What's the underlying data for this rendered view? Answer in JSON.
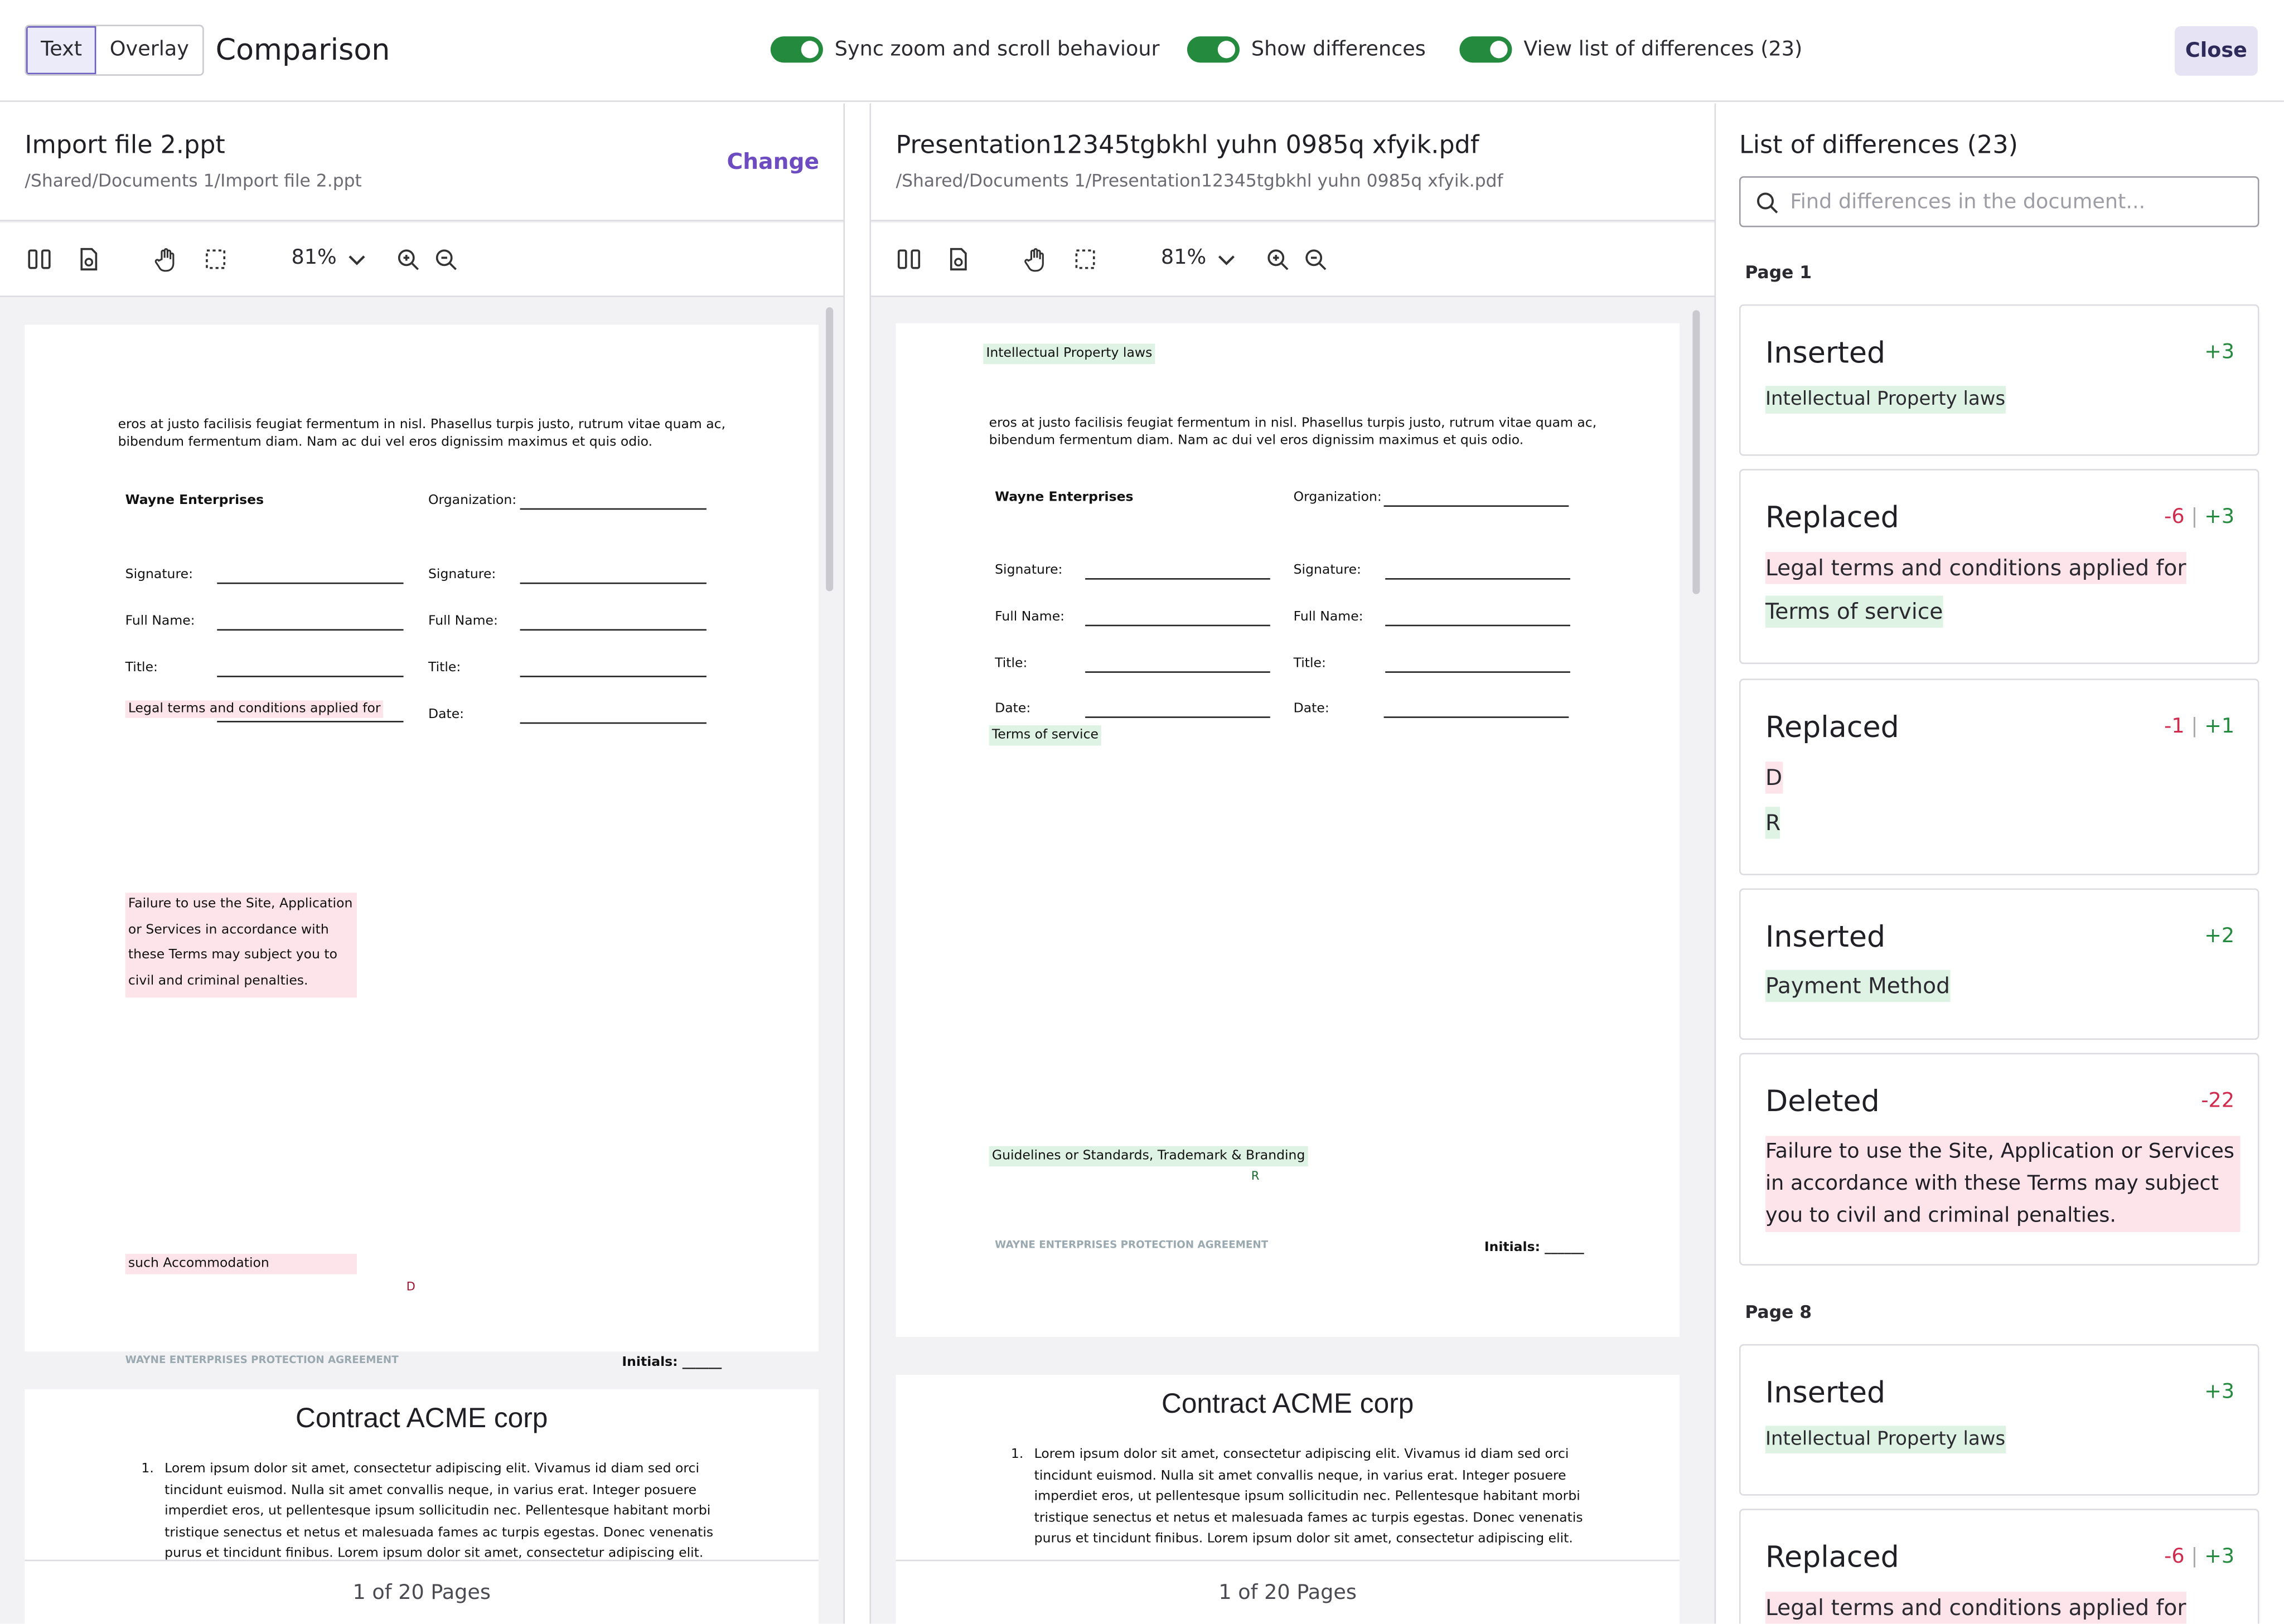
{
  "toolbar": {
    "mode_text": "Text",
    "mode_overlay": "Overlay",
    "title": "Comparison",
    "toggle_sync": "Sync zoom and scroll behaviour",
    "toggle_show": "Show differences",
    "toggle_list": "View list of differences (23)",
    "close": "Close"
  },
  "left": {
    "file_name": "Import file 2.ppt",
    "file_path": "/Shared/Documents 1/Import file 2.ppt",
    "change": "Change",
    "zoom": "81%",
    "footer": "1 of 20 Pages"
  },
  "right": {
    "file_name": "Presentation12345tgbkhl yuhn 0985q xfyik.pdf",
    "file_path": "/Shared/Documents 1/Presentation12345tgbkhl yuhn 0985q xfyik.pdf",
    "zoom": "81%",
    "footer": "1 of 20 Pages"
  },
  "doc": {
    "para1": "eros at justo facilisis feugiat fermentum in nisl. Phasellus turpis justo, rutrum vitae quam ac,",
    "para2": "bibendum fermentum diam. Nam ac dui vel eros dignissim maximus et quis odio.",
    "company": "Wayne Enterprises",
    "organization": "Organization:",
    "signature": "Signature:",
    "full_name": "Full Name:",
    "title_label": "Title:",
    "date_label": "Date:",
    "footer_agreement": "WAYNE ENTERPRISES PROTECTION AGREEMENT",
    "initials": "Initials: ______",
    "contract_title": "Contract ACME corp",
    "num": "1.",
    "lorem1": "Lorem ipsum dolor sit amet, consectetur adipiscing elit. Vivamus id diam sed orci",
    "lorem2": "tincidunt euismod. Nulla sit amet convallis neque, in varius erat. Integer posuere",
    "lorem3": "imperdiet eros, ut pellentesque ipsum sollicitudin nec. Pellentesque habitant morbi",
    "lorem4": "tristique senectus et netus et malesuada fames ac turpis egestas. Donec venenatis",
    "lorem5": "purus et tincidunt finibus. Lorem ipsum dolor sit amet, consectetur adipiscing elit.",
    "legal": "Legal terms and conditions applied for",
    "failure1": "Failure to use the Site, Application",
    "failure2": "or Services in accordance with",
    "failure3": "these Terms may subject you to",
    "failure4": "civil and criminal penalties.",
    "accommodation": "such Accommodation",
    "letter_d": "D",
    "letter_r": "R",
    "ip_laws": "Intellectual Property laws",
    "terms": "Terms of service",
    "guidelines": "Guidelines or Standards, Trademark & Branding"
  },
  "diffs": {
    "title": "List of differences (23)",
    "search_placeholder": "Find differences in the document...",
    "page1": "Page 1",
    "page8": "Page 8",
    "cards": [
      {
        "type": "Inserted",
        "plus": "+3",
        "text": "Intellectual Property laws"
      },
      {
        "type": "Replaced",
        "minus": "-6",
        "plus": "+3",
        "old": "Legal terms and conditions applied for",
        "new": "Terms of service"
      },
      {
        "type": "Replaced",
        "minus": "-1",
        "plus": "+1",
        "old": "D",
        "new": "R"
      },
      {
        "type": "Inserted",
        "plus": "+2",
        "text": "Payment Method"
      },
      {
        "type": "Deleted",
        "minus": "-22",
        "l1": "Failure to use the Site, Application or Services",
        "l2": "in accordance with these Terms may subject",
        "l3": "you to civil and criminal penalties."
      },
      {
        "type": "Inserted",
        "plus": "+3",
        "text": "Intellectual Property laws"
      },
      {
        "type": "Replaced",
        "minus": "-6",
        "plus": "+3",
        "old": "Legal terms and conditions applied for"
      }
    ]
  },
  "colors": {
    "accent": "#6d4bc0",
    "insert": "#248a3d",
    "delete": "#d12a4d",
    "toggle": "#248a3d"
  },
  "icons": [
    "split-view-icon",
    "document-settings-icon",
    "hand-pan-icon",
    "selection-icon",
    "chevron-down-icon",
    "zoom-in-icon",
    "zoom-out-icon",
    "search-icon"
  ]
}
